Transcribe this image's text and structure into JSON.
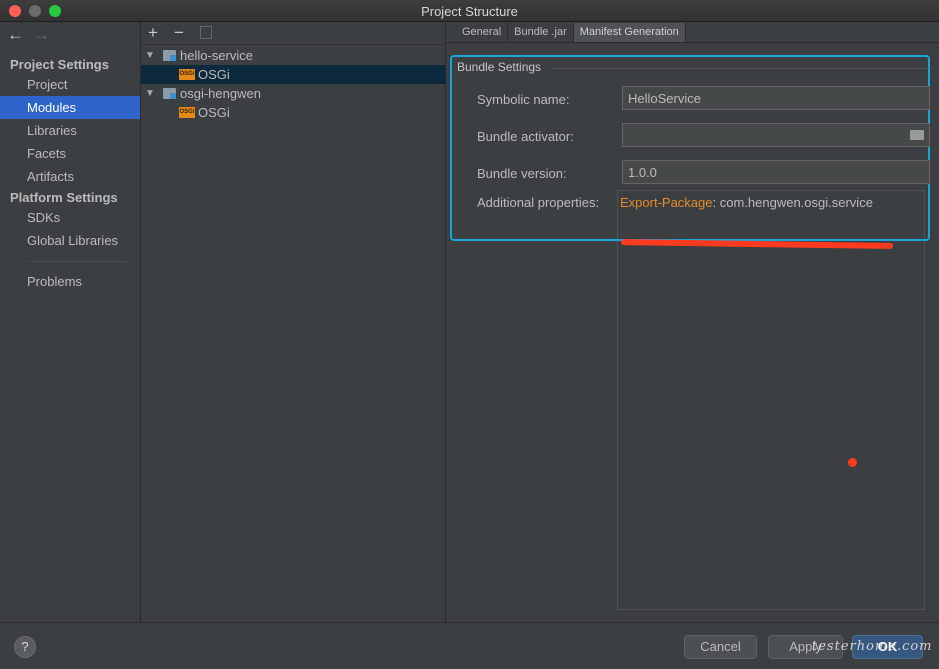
{
  "window": {
    "title": "Project Structure"
  },
  "nav": {
    "back_icon": "←",
    "forward_icon": "→"
  },
  "sidebar": {
    "project_settings_header": "Project Settings",
    "platform_settings_header": "Platform Settings",
    "items": [
      {
        "label": "Project"
      },
      {
        "label": "Modules"
      },
      {
        "label": "Libraries"
      },
      {
        "label": "Facets"
      },
      {
        "label": "Artifacts"
      },
      {
        "label": "SDKs"
      },
      {
        "label": "Global Libraries"
      },
      {
        "label": "Problems"
      }
    ],
    "selected": "Modules"
  },
  "tree": {
    "toolbar": {
      "add": "+",
      "remove": "−"
    },
    "badge_text": "OSGi",
    "nodes": [
      {
        "label": "hello-service"
      },
      {
        "label": "OSGi",
        "selected": true
      },
      {
        "label": "osgi-hengwen"
      },
      {
        "label": "OSGi"
      }
    ]
  },
  "tabs": [
    {
      "label": "General"
    },
    {
      "label": "Bundle .jar"
    },
    {
      "label": "Manifest Generation",
      "active": true
    }
  ],
  "bundle_settings": {
    "title": "Bundle Settings",
    "symbolic_name_label": "Symbolic name:",
    "symbolic_name_value": "HelloService",
    "activator_label": "Bundle activator:",
    "activator_value": "",
    "version_label": "Bundle version:",
    "version_value": "1.0.0",
    "additional_label": "Additional properties:",
    "additional_key": "Export-Package",
    "additional_sep": ":",
    "additional_value": " com.hengwen.osgi.service"
  },
  "footer": {
    "help": "?",
    "cancel": "Cancel",
    "apply": "Apply",
    "ok": "OK",
    "watermark": "testerhome.com"
  },
  "colors": {
    "accent_selection": "#2f65ca",
    "highlight_border": "#1ba3da",
    "property_key": "#e58a2a",
    "annotation_red": "#ff3b1f"
  }
}
